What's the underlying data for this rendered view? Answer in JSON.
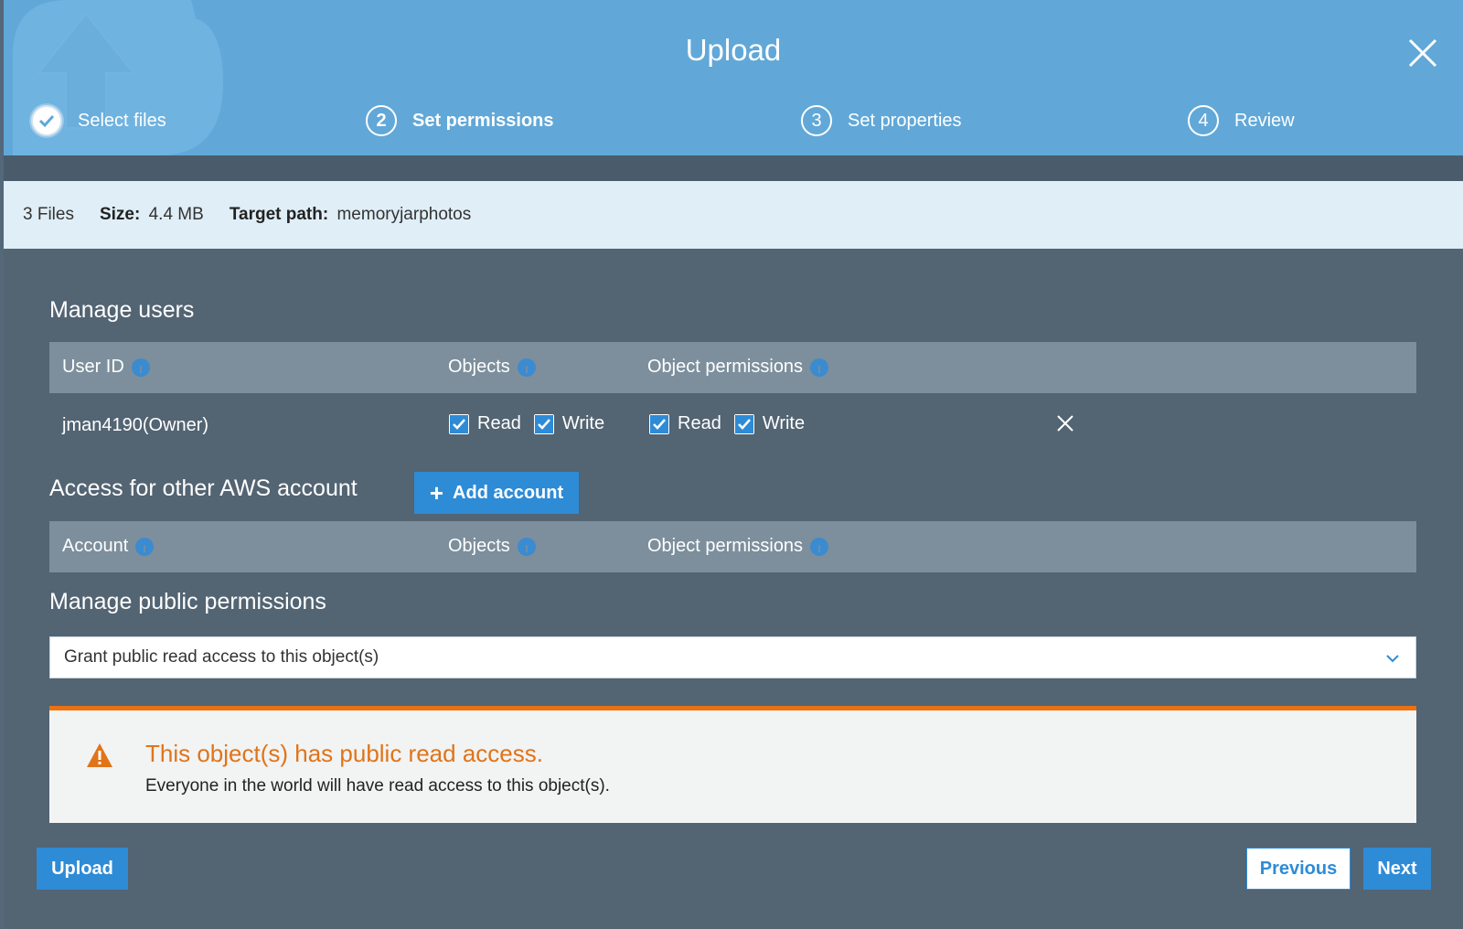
{
  "header": {
    "title": "Upload",
    "steps": [
      {
        "number": "",
        "label": "Select files",
        "state": "done"
      },
      {
        "number": "2",
        "label": "Set permissions",
        "state": "active"
      },
      {
        "number": "3",
        "label": "Set properties",
        "state": "pending"
      },
      {
        "number": "4",
        "label": "Review",
        "state": "pending"
      }
    ]
  },
  "summary": {
    "files": "3 Files",
    "size_label": "Size:",
    "size_value": "4.4 MB",
    "path_label": "Target path:",
    "path_value": "memoryjarphotos"
  },
  "manage_users": {
    "title": "Manage users",
    "columns": [
      "User ID",
      "Objects",
      "Object permissions"
    ],
    "rows": [
      {
        "user_id": "jman4190(Owner)",
        "objects": {
          "read_label": "Read",
          "read": true,
          "write_label": "Write",
          "write": true
        },
        "object_permissions": {
          "read_label": "Read",
          "read": true,
          "write_label": "Write",
          "write": true
        }
      }
    ]
  },
  "other_accounts": {
    "title": "Access for other AWS account",
    "add_button": "Add account",
    "columns": [
      "Account",
      "Objects",
      "Object permissions"
    ]
  },
  "public_permissions": {
    "title": "Manage public permissions",
    "selected": "Grant public read access to this object(s)"
  },
  "alert": {
    "title": "This object(s) has public read access.",
    "body": "Everyone in the world will have read access to this object(s)."
  },
  "footer": {
    "upload": "Upload",
    "previous": "Previous",
    "next": "Next"
  },
  "colors": {
    "header_bg": "#61a8d8",
    "body_bg": "#536473",
    "accent": "#2e8bd6",
    "warning": "#ec7211"
  }
}
